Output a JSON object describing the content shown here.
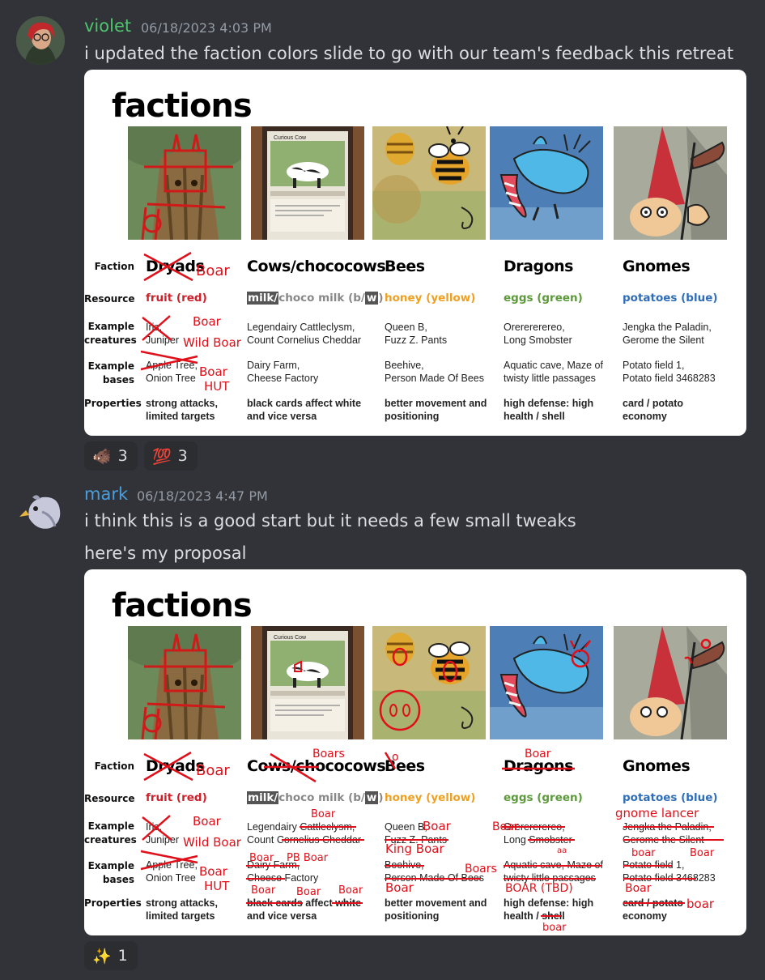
{
  "messages": [
    {
      "username": "violet",
      "timestamp": "06/18/2023 4:03 PM",
      "lines": [
        "i updated the faction colors slide to go with our team's feedback this retreat"
      ],
      "reactions": [
        {
          "emoji": "🐗",
          "count": "3"
        },
        {
          "emoji": "💯",
          "count": "3"
        }
      ]
    },
    {
      "username": "mark",
      "timestamp": "06/18/2023 4:47 PM",
      "lines": [
        "i think this is a good start but it needs a few small tweaks",
        "here's my proposal"
      ],
      "reactions": [
        {
          "emoji": "✨",
          "count": "1"
        }
      ]
    }
  ],
  "slide": {
    "title": "factions",
    "row_labels": {
      "faction": "Faction",
      "resource": "Resource",
      "creatures": [
        "Example",
        "creatures"
      ],
      "bases": [
        "Example",
        "bases"
      ],
      "properties": "Properties"
    },
    "card_label": "Curious Cow",
    "factions": [
      {
        "name": "Dryads",
        "resource": "fruit (red)",
        "resource_color": "#d0202a",
        "creatures": [
          "Iris,",
          "Juniper"
        ],
        "bases": [
          "Apple Tree,",
          "Onion Tree"
        ],
        "properties": [
          "strong attacks,",
          "limited targets"
        ]
      },
      {
        "name": "Cows/chococows",
        "resource_a": "milk/",
        "resource_b": "choco milk (b/",
        "resource_c": "w",
        "resource_d": ")",
        "resource_color": "#888888",
        "creatures": [
          "Legendairy Cattleclysm,",
          "Count Cornelius Cheddar"
        ],
        "bases": [
          "Dairy Farm,",
          "Cheese Factory"
        ],
        "properties": [
          "black cards affect white",
          "and vice versa"
        ]
      },
      {
        "name": "Bees",
        "resource": "honey (yellow)",
        "resource_color": "#f0a020",
        "creatures": [
          "Queen B,",
          "Fuzz Z. Pants"
        ],
        "bases": [
          "Beehive,",
          "Person Made Of Bees"
        ],
        "properties": [
          "better movement and",
          "positioning"
        ]
      },
      {
        "name": "Dragons",
        "resource": "eggs (green)",
        "resource_color": "#5c9a3a",
        "creatures": [
          "Orerererereo,",
          "Long Smobster"
        ],
        "bases": [
          "Aquatic cave, Maze of",
          "twisty little passages"
        ],
        "properties": [
          "high defense: high",
          "health / shell"
        ]
      },
      {
        "name": "Gnomes",
        "resource": "potatoes (blue)",
        "resource_color": "#2f6db8",
        "creatures": [
          "Jengka the Paladin,",
          "Gerome the Silent"
        ],
        "bases": [
          "Potato field 1,",
          "Potato field 3468283"
        ],
        "properties": [
          "card / potato",
          "economy"
        ]
      }
    ],
    "annotations_violet": {
      "faction": "Boar",
      "creature_1": "Boar",
      "creature_2": "Wild Boar",
      "base_1": "Boar",
      "base_2": "HUT"
    },
    "annotations_mark": {
      "cows_name": "Boars",
      "bees_mark": "o",
      "dragons_name": "Boar",
      "cows_creature": "Boar",
      "bees_creature_1": "Boar",
      "bees_creature_2": "King Boar",
      "dragons_creature": "Boar",
      "dragons_sub": "aa",
      "gnomes_creature": "gnome lancer",
      "cows_base_1": "Boar",
      "cows_base_2": "PB Boar",
      "bees_base": "Boar",
      "dragons_base_1": "Boars",
      "dragons_base_2": "BOAR (TBD)",
      "gnomes_base_1": "boar",
      "gnomes_base_2": "Boar",
      "gnomes_base_3": "Boar",
      "cows_prop_1": "Boar",
      "cows_prop_2": "Boar",
      "cows_prop_3": "Boar",
      "dragons_prop": "boar",
      "gnomes_prop": "boar"
    }
  }
}
